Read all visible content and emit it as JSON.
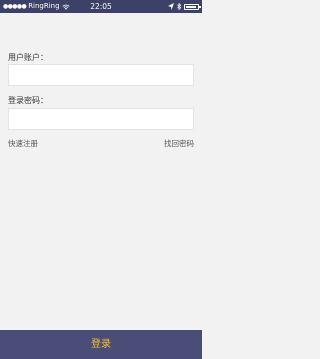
{
  "status_bar": {
    "signal": "●●●●●",
    "carrier": "RingRing",
    "time": "22:05",
    "battery_level": 0.9,
    "colors": {
      "background": "#3d4168",
      "foreground": "#ffffff"
    },
    "icons": [
      "wifi-icon",
      "location-icon",
      "bluetooth-icon",
      "battery-icon"
    ]
  },
  "form": {
    "account_label": "用户账户：",
    "account_value": "",
    "password_label": "登录密码：",
    "password_value": ""
  },
  "links": {
    "register": "快速注册",
    "forgot_password": "找回密码"
  },
  "login_button": {
    "label": "登录",
    "colors": {
      "background": "#4a4d77",
      "text": "#f3c12f"
    }
  },
  "page": {
    "background": "#f2f2f2"
  }
}
